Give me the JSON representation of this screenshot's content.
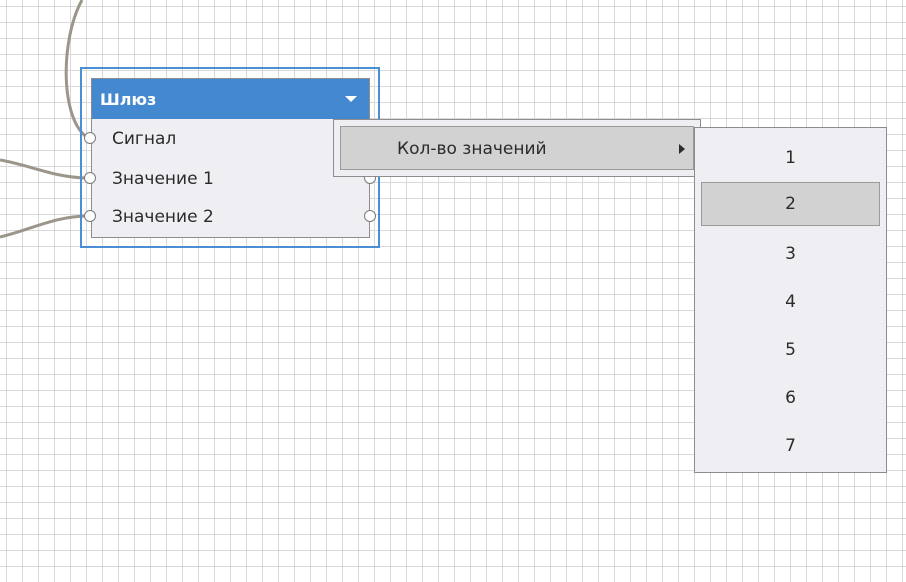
{
  "node": {
    "title": "Шлюз",
    "ports": [
      "Сигнал",
      "Значение 1",
      "Значение 2"
    ]
  },
  "context_menu": {
    "item_label": "Кол-во значений"
  },
  "submenu": {
    "options": [
      "1",
      "2",
      "3",
      "4",
      "5",
      "6",
      "7"
    ],
    "selected": "2"
  },
  "colors": {
    "header_blue": "#4489cf",
    "selection_border": "#4a8fd6",
    "highlight": "#d2d2d2",
    "wire": "#9c968a"
  }
}
